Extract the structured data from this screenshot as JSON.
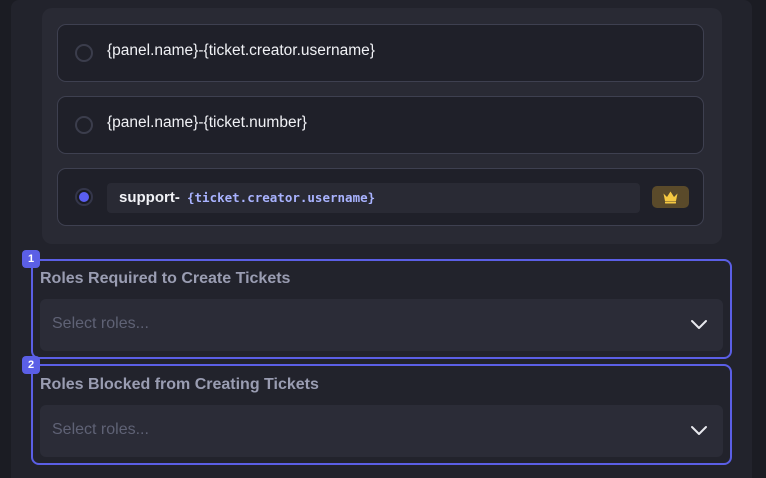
{
  "ticket_name_options": [
    {
      "label": "{panel.name}-{ticket.creator.username}",
      "selected": false
    },
    {
      "label": "{panel.name}-{ticket.number}",
      "selected": false
    },
    {
      "prefix": "support-",
      "variable": "{ticket.creator.username}",
      "selected": true,
      "premium_icon": "crown-icon"
    }
  ],
  "roles_required": {
    "badge": "1",
    "label": "Roles Required to Create Tickets",
    "placeholder": "Select roles..."
  },
  "roles_blocked": {
    "badge": "2",
    "label": "Roles Blocked from Creating Tickets",
    "placeholder": "Select roles..."
  },
  "colors": {
    "accent": "#5b5fe6",
    "premium_badge": "#5a4a2a",
    "crown": "#f5c842",
    "code_variable": "#a9b3ff"
  }
}
